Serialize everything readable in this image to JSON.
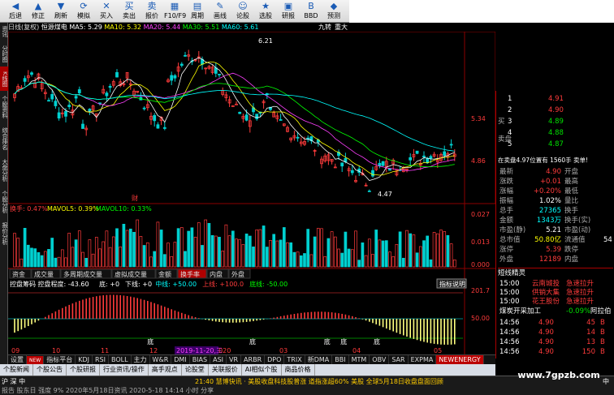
{
  "toolbar": {
    "buttons": [
      {
        "label": "后退",
        "icon": "left-arrow"
      },
      {
        "label": "修正",
        "icon": "up-arrow"
      },
      {
        "label": "刷新",
        "icon": "down-arrow"
      },
      {
        "label": "模拟",
        "icon": "refresh"
      },
      {
        "label": "买入",
        "icon": "stop"
      },
      {
        "label": "卖出",
        "icon": "buy"
      },
      {
        "label": "报价",
        "icon": "sell"
      },
      {
        "label": "F10/F9",
        "icon": "grid"
      },
      {
        "label": "周期",
        "icon": "calendar"
      },
      {
        "label": "画线",
        "icon": "pencil"
      },
      {
        "label": "论股",
        "icon": "people"
      },
      {
        "label": "选股",
        "icon": "star"
      },
      {
        "label": "研报",
        "icon": "doc"
      },
      {
        "label": "BBD",
        "icon": "bbd"
      },
      {
        "label": "预测",
        "icon": "forecast"
      }
    ]
  },
  "chart_title": {
    "period": "日线(复权)",
    "name": "恒源煤电",
    "ma5": "MA5: 5.29",
    "ma10": "MA10: 5.32",
    "ma20": "MA20: 5.44",
    "ma30": "MA30: 5.51",
    "ma60": "MA60: 5.61",
    "right1": "九转",
    "right2": "重大"
  },
  "left_tabs": [
    "资讯",
    "分时图",
    "K线图",
    "个股资料",
    "综合排名",
    "大盘分析",
    "个股分析",
    "报价分析"
  ],
  "price_axis": [
    "5.34",
    "4.86"
  ],
  "annotations": {
    "high": "6.21",
    "low": "4.47",
    "cai": "财"
  },
  "volume_title": {
    "label": "换手: 0.47%",
    "mavol5": "MAVOL5: 0.39%",
    "mavol10": "MAVOL10: 0.33%"
  },
  "volume_axis": [
    "0.027",
    "0.013",
    "0.000"
  ],
  "sub_tabs": [
    "资金",
    "成交量",
    "多周期成交量",
    "虚拟成交量",
    "金额",
    "换手率",
    "内盘",
    "外盘"
  ],
  "indicator": {
    "title": "控盘筹码 控盘程度: -43.60",
    "items": [
      {
        "text": "底: +0",
        "color": "#ffffff"
      },
      {
        "text": "下线: +0",
        "color": "#ffffff"
      },
      {
        "text": "中线: +50.00",
        "color": "#00ffff"
      },
      {
        "text": "上线: +100.0",
        "color": "#ff3b3b"
      },
      {
        "text": "底线: -50.00",
        "color": "#00ff00"
      }
    ],
    "help": "指标说明",
    "axis": [
      "201.7",
      "50.00"
    ],
    "markers": [
      "底",
      "底",
      "底",
      "底",
      "底"
    ]
  },
  "x_axis": {
    "labels": [
      "09",
      "10",
      "11",
      "12",
      "2020",
      "03",
      "04",
      "05"
    ],
    "highlight": "2019-11-20,三"
  },
  "bottom_tabs": [
    "设置",
    "NEW",
    "指标平台",
    "KDJ",
    "RSI",
    "BOLL",
    "主力",
    "W&R",
    "DMI",
    "BIAS",
    "ASI",
    "VR",
    "ARBR",
    "DPO",
    "TRIX",
    "新DMA",
    "BBI",
    "MTM",
    "OBV",
    "SAR",
    "EXPMA",
    "NEWENERGY"
  ],
  "func_tabs": [
    "个股新闻",
    "个股公告",
    "个股研报",
    "行业资讯/操作",
    "高手观点",
    "论股堂",
    "关联报价",
    "AI相似个股",
    "商品价格"
  ],
  "order_book": {
    "sell": [
      {
        "n": "1",
        "p": "4.91"
      },
      {
        "n": "2",
        "p": "4.90"
      },
      {
        "n": "3",
        "p": "4.89"
      },
      {
        "n": "4",
        "p": "4.88"
      },
      {
        "n": "5",
        "p": "4.87"
      }
    ],
    "sell_label": "卖盘",
    "buy_label": "买",
    "summary": "在卖盘4.97位置有 1560手 卖单!"
  },
  "quote": [
    {
      "l": "最新",
      "v": "4.90",
      "c": "#ff3b3b",
      "l2": "开盘",
      "v2": ""
    },
    {
      "l": "涨跌",
      "v": "+0.01",
      "c": "#ff3b3b",
      "l2": "最高",
      "v2": ""
    },
    {
      "l": "涨幅",
      "v": "+0.20%",
      "c": "#ff3b3b",
      "l2": "最低",
      "v2": ""
    },
    {
      "l": "振幅",
      "v": "1.02%",
      "c": "#ffffff",
      "l2": "量比",
      "v2": ""
    },
    {
      "l": "总手",
      "v": "27365",
      "c": "#00ffff",
      "l2": "换手",
      "v2": ""
    },
    {
      "l": "金额",
      "v": "1343万",
      "c": "#00ffff",
      "l2": "换手(实)",
      "v2": ""
    },
    {
      "l": "市盈(静)",
      "v": "5.21",
      "c": "#ffffff",
      "l2": "市盈(动)",
      "v2": ""
    },
    {
      "l": "总市值",
      "v": "50.80亿",
      "c": "#ffff00",
      "l2": "流通值",
      "v2": "54"
    },
    {
      "l": "涨停",
      "v": "5.39",
      "c": "#ff3b3b",
      "l2": "跌停",
      "v2": ""
    },
    {
      "l": "外盘",
      "v": "12189",
      "c": "#ff3b3b",
      "l2": "内盘",
      "v2": ""
    }
  ],
  "news": {
    "header": "短线精灵",
    "items": [
      {
        "t": "15:00",
        "s": "云南城投",
        "e": "急速拉升"
      },
      {
        "t": "15:00",
        "s": "供销大集",
        "e": "急速拉升"
      },
      {
        "t": "15:00",
        "s": "花王股份",
        "e": "急速拉升"
      }
    ],
    "sector": "煤炭开采加工",
    "sector_chg": "-0.09%",
    "sector_more": "阿拉伯"
  },
  "ticks": [
    {
      "t": "14:56",
      "p": "4.90",
      "v": "45",
      "d": "B"
    },
    {
      "t": "14:56",
      "p": "4.90",
      "v": "14",
      "d": "B"
    },
    {
      "t": "14:56",
      "p": "4.90",
      "v": "13",
      "d": "B"
    },
    {
      "t": "14:56",
      "p": "4.90",
      "v": "150",
      "d": "B"
    }
  ],
  "status": {
    "left": "沪  深  中",
    "ticker": "21:40 慧博快讯 · 美股收盘科技股普涨 道指涨超60%  美股 全球5月18日收盘盘面回顾",
    "right": "中",
    "row2": "报告   股东日   强度   9%  2020年5月18日资讯 2020-5-18 14:14 小时 分享"
  },
  "watermark": "www.7gpzb.com"
}
